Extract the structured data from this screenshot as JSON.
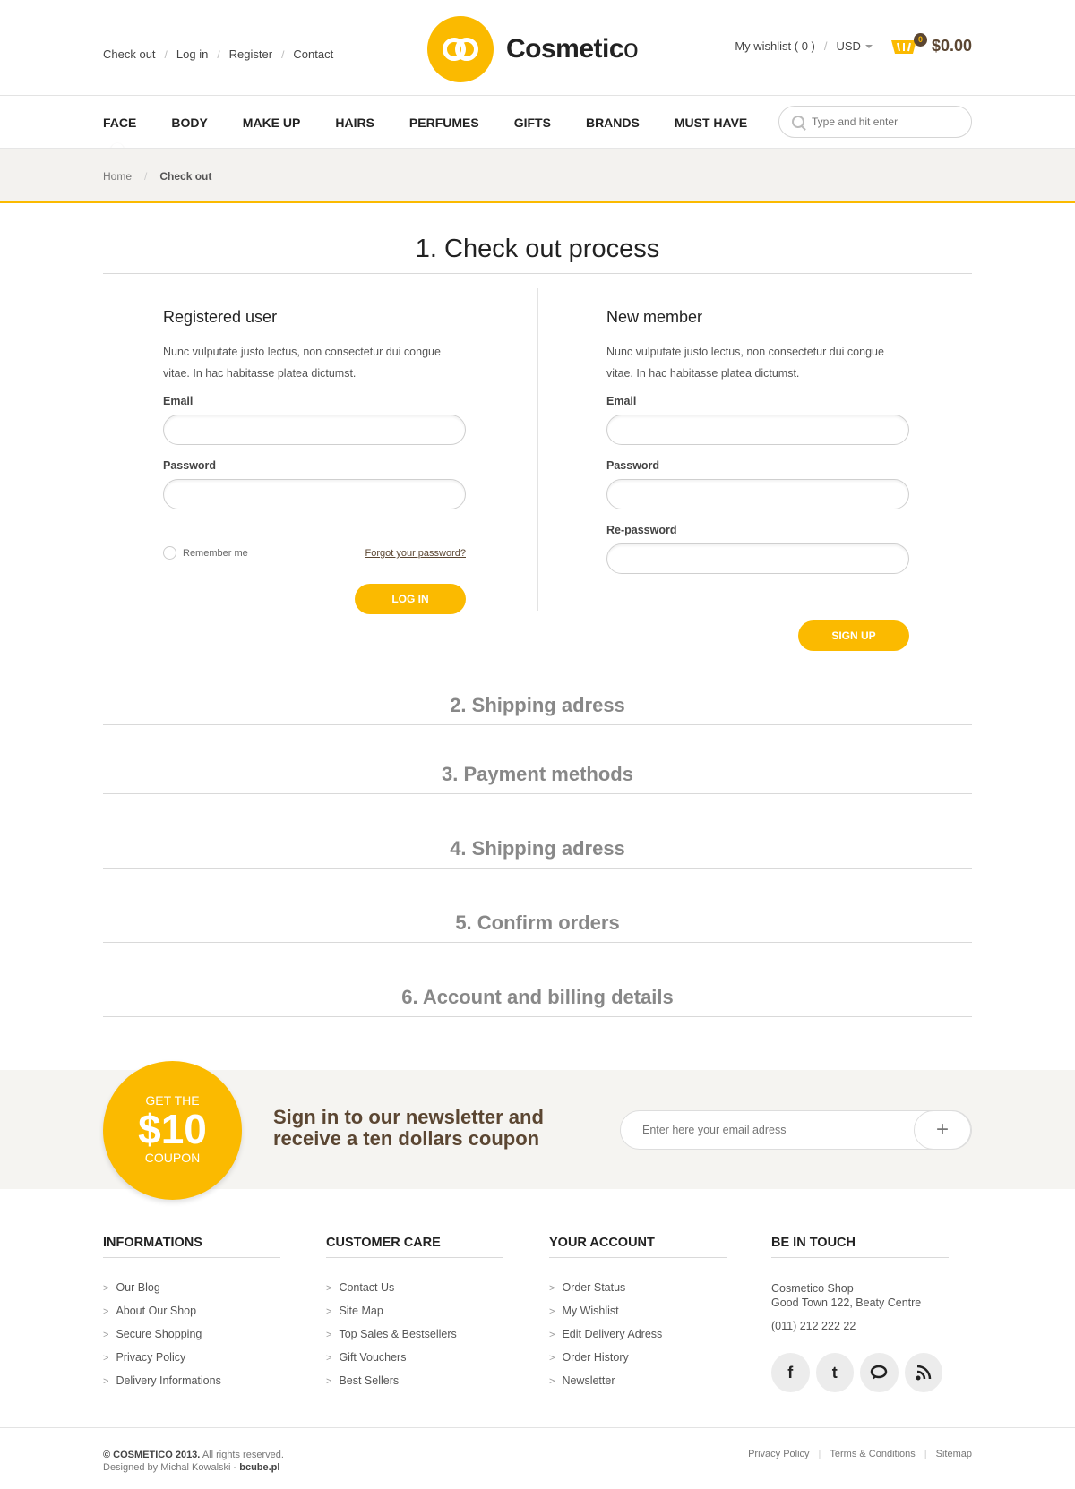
{
  "top": {
    "links": [
      "Check out",
      "Log in",
      "Register",
      "Contact"
    ],
    "brand_bold": "Cosmetic",
    "brand_light": "o",
    "wishlist": "My wishlist ( 0 )",
    "currency": "USD",
    "cart_count": "0",
    "cart_total": "$0.00"
  },
  "nav": {
    "items": [
      "FACE",
      "BODY",
      "MAKE UP",
      "HAIRS",
      "PERFUMES",
      "GIFTS",
      "BRANDS",
      "MUST HAVE"
    ],
    "search_placeholder": "Type and hit enter"
  },
  "breadcrumb": [
    "Home",
    "Check out"
  ],
  "checkout": {
    "title": "1. Check out process",
    "registered": {
      "heading": "Registered user",
      "text": "Nunc vulputate justo lectus, non consectetur dui congue vitae. In hac habitasse platea dictumst.",
      "email_label": "Email",
      "password_label": "Password",
      "remember": "Remember me",
      "forgot": "Forgot your password?",
      "button": "LOG IN"
    },
    "new_member": {
      "heading": "New member",
      "text": "Nunc vulputate justo lectus, non consectetur dui congue vitae. In hac habitasse platea dictumst.",
      "email_label": "Email",
      "password_label": "Password",
      "repassword_label": "Re-password",
      "button": "SIGN UP"
    },
    "steps": [
      "2. Shipping adress",
      "3. Payment methods",
      "4. Shipping adress",
      "5. Confirm orders",
      "6. Account and billing details"
    ]
  },
  "newsletter": {
    "coupon_top": "GET THE",
    "coupon_value": "$10",
    "coupon_bottom": "COUPON",
    "text": "Sign in to our newsletter and receive a ten dollars coupon",
    "placeholder": "Enter here your email adress",
    "submit": "+"
  },
  "footer": {
    "informations": {
      "title": "INFORMATIONS",
      "items": [
        "Our Blog",
        "About Our Shop",
        "Secure Shopping",
        "Privacy Policy",
        "Delivery Informations"
      ]
    },
    "customer_care": {
      "title": "CUSTOMER CARE",
      "items": [
        "Contact Us",
        "Site Map",
        "Top Sales & Bestsellers",
        "Gift Vouchers",
        "Best Sellers"
      ]
    },
    "account": {
      "title": "YOUR ACCOUNT",
      "items": [
        "Order Status",
        "My Wishlist",
        "Edit Delivery Adress",
        "Order History",
        "Newsletter"
      ]
    },
    "touch": {
      "title": "BE IN TOUCH",
      "shop": "Cosmetico Shop",
      "address": "Good Town 122, Beaty Centre",
      "phone": "(011) 212 222 22"
    },
    "copyright_bold": "© COSMETICO 2013.",
    "copyright": "All rights reserved.",
    "designed": "Designed by Michal Kowalski - ",
    "designed_site": "bcube.pl",
    "links": [
      "Privacy Policy",
      "Terms & Conditions",
      "Sitemap"
    ]
  },
  "colors": {
    "accent": "#fbba00",
    "brown": "#5b4632"
  }
}
